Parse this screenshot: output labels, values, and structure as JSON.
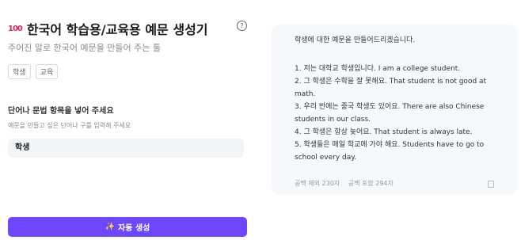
{
  "header": {
    "emoji": "100",
    "title": "한국어 학습용/교육용 예문 생성기",
    "help": "?",
    "subtitle": "주어진 말로 한국어 예문을 만들어 주는 툴"
  },
  "tags": [
    "학생",
    "교육"
  ],
  "form": {
    "label": "단어나 문법 항목을 넣어 주세요",
    "help": "예문을 만들고 싶은 단어나 구를 입력해 주세요",
    "value": "학생",
    "button_label": "자동 생성"
  },
  "result": {
    "intro": "학생에 대한 예문을 만들어드리겠습니다.",
    "lines": [
      "1. 저는 대학교 학생입니다. I am a college student.",
      "2. 그 학생은 수학을 잘 못해요. That student is not good at math.",
      "3. 우리 반에는 중국 학생도 있어요. There are also Chinese students in our class.",
      "4. 그 학생은 항상 늦어요. That student is always late.",
      "5. 학생들은 매일 학교에 가야 해요. Students have to go to school every day."
    ],
    "stats_no_space": "공백 제외 230자",
    "stats_with_space": "공백 포함 294자"
  },
  "colors": {
    "accent": "#6c47ff",
    "panel": "#f7f8fb",
    "input": "#f3f4f8"
  }
}
